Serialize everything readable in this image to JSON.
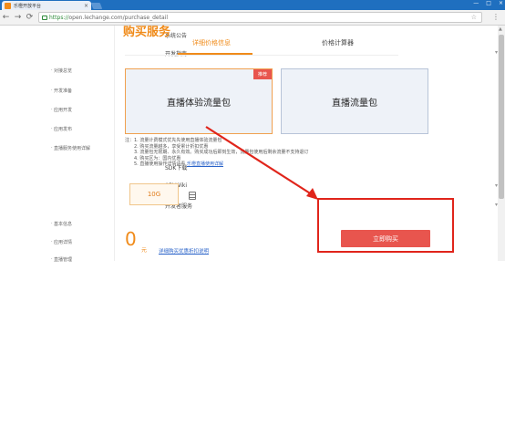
{
  "browser": {
    "tab_title": "乐橙开放平台",
    "tab_close": "×",
    "window_controls": [
      "—",
      "□",
      "×"
    ],
    "nav": {
      "back": "←",
      "forward": "→",
      "reload": "⟳"
    },
    "url_secure": "https://",
    "url_host": "open.lechange.com",
    "url_path": "/purchase_detail",
    "menu": "⋮"
  },
  "sidebar": {
    "items": [
      {
        "label": "系统公告",
        "type": "main"
      },
      {
        "label": "开发指南",
        "type": "main",
        "arrow": "▾"
      },
      {
        "label": "对接总览",
        "type": "sub"
      },
      {
        "label": "开发准备",
        "type": "sub"
      },
      {
        "label": "应用开发",
        "type": "sub"
      },
      {
        "label": "应用发布",
        "type": "sub"
      },
      {
        "label": "直播服务使用详解",
        "type": "sub"
      },
      {
        "label": "SDK下载",
        "type": "main"
      },
      {
        "label": "API Wiki",
        "type": "main",
        "arrow": "▾"
      },
      {
        "label": "开发者服务",
        "type": "main",
        "arrow": "▾"
      },
      {
        "label": "基本信息",
        "type": "sub"
      },
      {
        "label": "应用详情",
        "type": "sub"
      },
      {
        "label": "直播管理",
        "type": "sub"
      }
    ]
  },
  "main": {
    "title": "购买服务",
    "tabs": [
      {
        "label": "详细价格信息",
        "active": true
      },
      {
        "label": "价格计算器",
        "active": false
      }
    ],
    "packages": [
      {
        "name": "直播体验流量包",
        "badge": "推荐",
        "selected": true
      },
      {
        "name": "直播流量包",
        "badge": "",
        "selected": false
      }
    ],
    "notes": [
      "注：1. 流量计费模式优先先使用直播体验流量包",
      "2. 购买流量越多，享受累计折扣优惠",
      "3. 流量包无限期、永久有效。购买成功后即刻生效，流量包使用后剩余流量不支持退订",
      "4. 购买区为：国内优惠",
      "5. 直播使用操作详情请看"
    ],
    "notes_link": "乐橙直播使用详解",
    "quantity": "10G",
    "price_value": "0",
    "price_unit": "元",
    "price_link": "详细购买优惠折扣说明",
    "buy_label": "立即购买"
  },
  "colors": {
    "accent": "#f08b1a",
    "buy": "#e8554e",
    "annotation": "#e0251b",
    "link": "#2a63c9"
  }
}
